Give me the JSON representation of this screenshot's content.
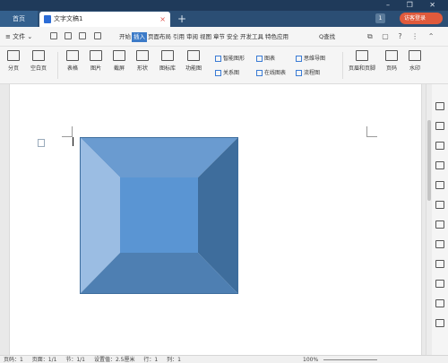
{
  "tabs": {
    "home_label": "首页",
    "doc_title": "文字文稿1",
    "close_glyph": "×",
    "add_glyph": "+",
    "page_count_badge": "1",
    "guest_label": "访客登录",
    "window_controls": "– ❐ ✕"
  },
  "menubar": {
    "file_label": "≡ 文件 ⌄",
    "items": [
      "开始",
      "插入",
      "页面布局",
      "引用",
      "审阅",
      "视图",
      "章节",
      "安全",
      "开发工具",
      "特色应用"
    ],
    "active_item": "插入",
    "search_label": "Q查找",
    "right_glyphs": "⧉ ▢ ? ⋮ ⌃"
  },
  "ribbon": {
    "pagebreak_label": "分页",
    "blankpage_label": "空白页",
    "table_label": "表格",
    "image_label": "图片",
    "screenshot_label": "截屏",
    "shape_label": "形状",
    "iconlib_label": "图标库",
    "funcmap_label": "功能图",
    "smartgraphic_label": "智能图形",
    "relation_label": "关系图",
    "chart_label": "图表",
    "onlinechart_label": "在线图表",
    "mindmap_label": "思维导图",
    "flowchart_label": "流程图",
    "headerfooter_label": "页眉和页脚",
    "pagenum_label": "页码",
    "watermark_label": "水印"
  },
  "status": {
    "page": "页码：1",
    "pages": "页面：1/1",
    "section": "节：1/1",
    "position": "设置值：2.5厘米",
    "row": "行：1",
    "col": "列：1",
    "zoom": "100%"
  },
  "colors": {
    "shape_top": "#6a9bd0",
    "shape_left": "#9bbde3",
    "shape_right": "#3e6d9c",
    "shape_bottom": "#4e7fb2",
    "shape_center": "#5a95d3",
    "accent": "#3c7bc8"
  }
}
